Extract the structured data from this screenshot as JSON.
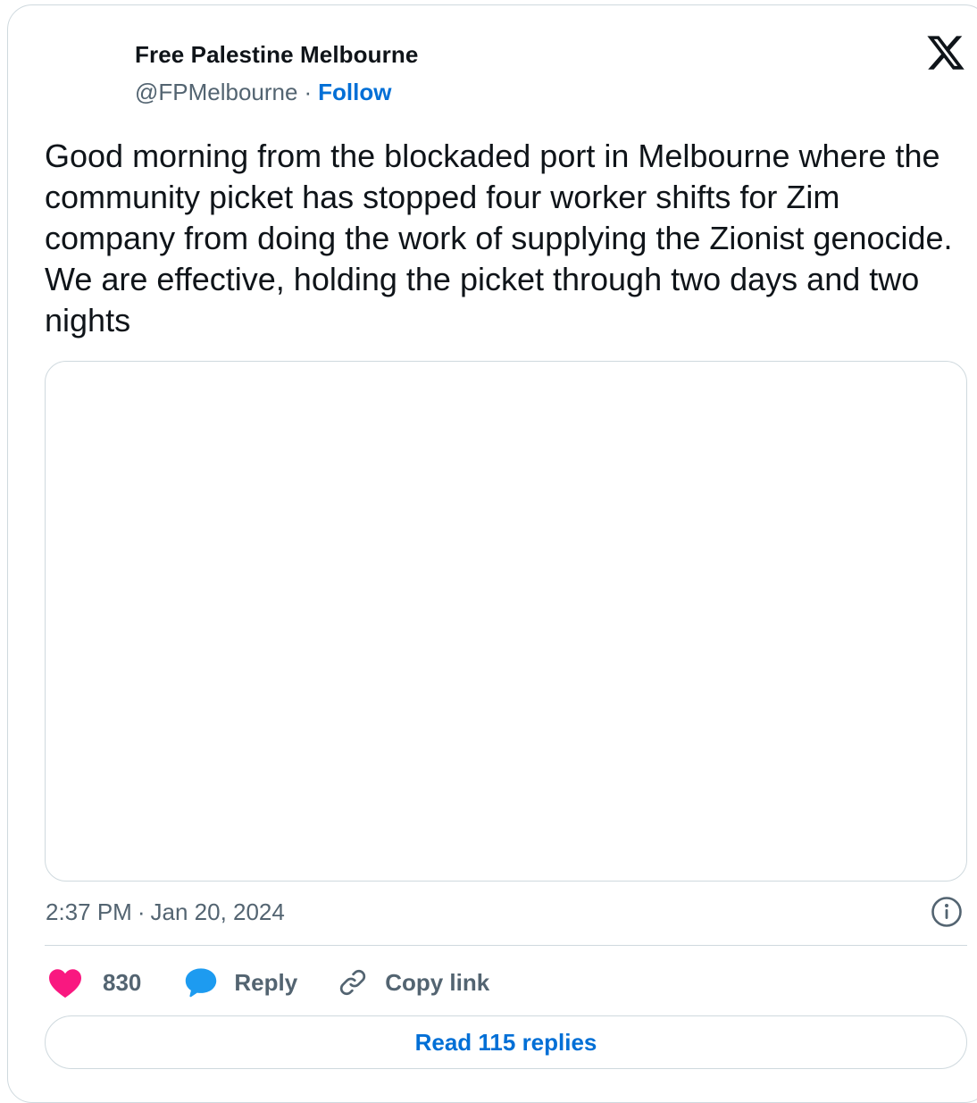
{
  "author": {
    "name": "Free Palestine Melbourne",
    "handle": "@FPMelbourne",
    "separator": "·",
    "follow_label": "Follow"
  },
  "tweet": {
    "text": "Good morning from the blockaded port in Melbourne where the community picket has stopped four worker shifts for Zim company from doing the work of supplying the Zionist genocide. We are effective, holding the picket through two days and two nights",
    "time": "2:37 PM",
    "separator": "·",
    "date": "Jan 20, 2024"
  },
  "actions": {
    "like_count": "830",
    "reply_label": "Reply",
    "copy_link_label": "Copy link"
  },
  "read_replies_label": "Read 115 replies",
  "colors": {
    "text_primary": "#0f1419",
    "text_secondary": "#536471",
    "link": "#006fd6",
    "like": "#f91880",
    "reply": "#1d9bf0",
    "border": "#cfd9de"
  },
  "icons": {
    "brand": "x-logo-icon",
    "info": "info-icon",
    "like": "heart-icon",
    "reply": "speech-bubble-icon",
    "copy": "link-icon"
  }
}
